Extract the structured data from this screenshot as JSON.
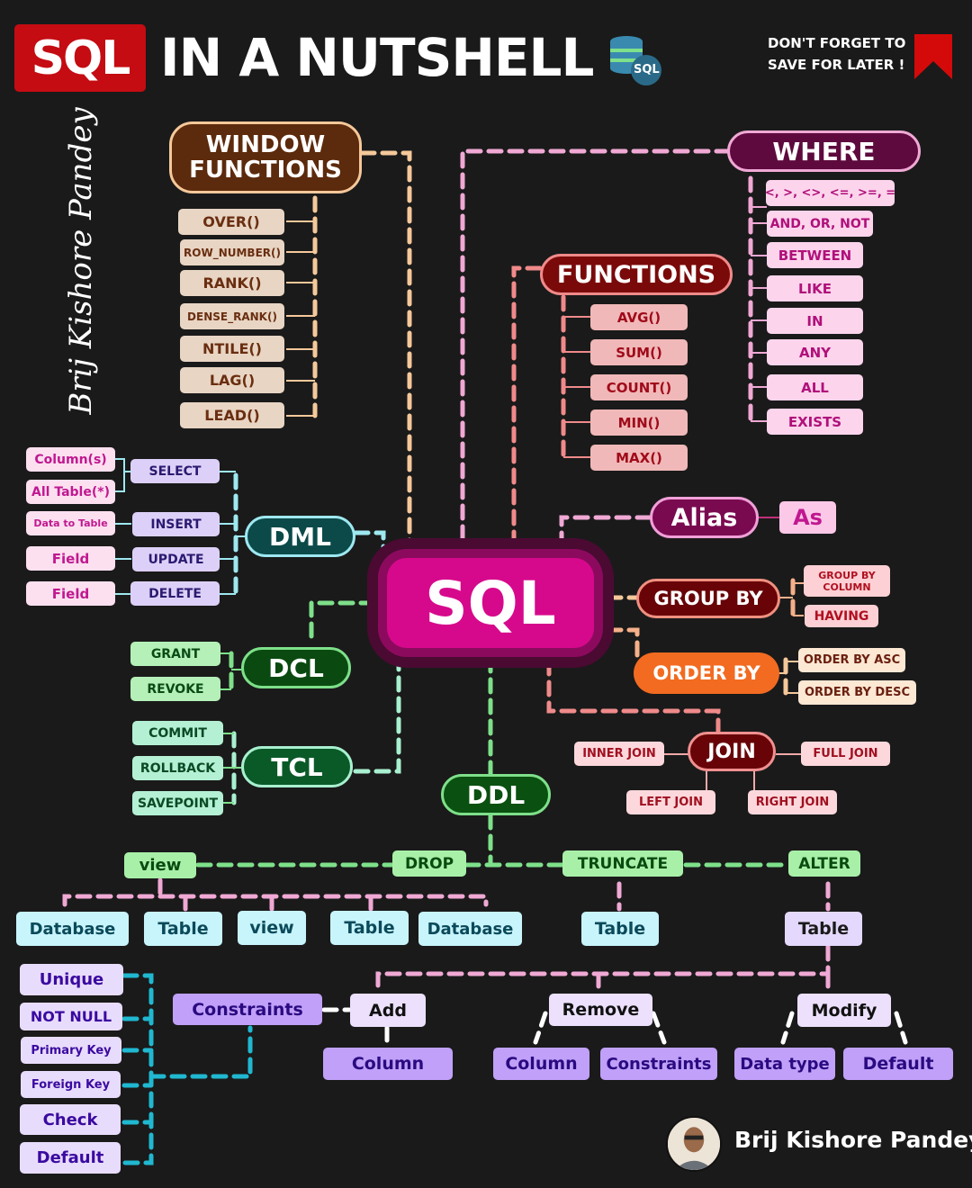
{
  "header": {
    "title_badge": "SQL",
    "title_text": "IN A NUTSHELL",
    "logo_text": "SQL",
    "save_note_line1": "DON'T FORGET TO",
    "save_note_line2": "SAVE FOR LATER !"
  },
  "author": {
    "vertical_signature": "Brij Kishore Pandey",
    "name": "Brij Kishore Pandey"
  },
  "center": {
    "label": "SQL"
  },
  "window_functions": {
    "title": "WINDOW FUNCTIONS",
    "items": [
      "OVER()",
      "ROW_NUMBER()",
      "RANK()",
      "DENSE_RANK()",
      "NTILE()",
      "LAG()",
      "LEAD()"
    ]
  },
  "where": {
    "title": "WHERE",
    "items": [
      "<, >, <>, <=, >=, =",
      "AND, OR, NOT",
      "BETWEEN",
      "LIKE",
      "IN",
      "ANY",
      "ALL",
      "EXISTS"
    ]
  },
  "functions": {
    "title": "FUNCTIONS",
    "items": [
      "AVG()",
      "SUM()",
      "COUNT()",
      "MIN()",
      "MAX()"
    ]
  },
  "dml": {
    "title": "DML",
    "commands": [
      "SELECT",
      "INSERT",
      "UPDATE",
      "DELETE"
    ],
    "targets": [
      "Column(s)",
      "All Table(*)",
      "Data to Table",
      "Field",
      "Field"
    ]
  },
  "alias": {
    "title": "Alias",
    "item": "As"
  },
  "group_by": {
    "title": "GROUP BY",
    "items": [
      "GROUP BY COLUMN",
      "HAVING"
    ]
  },
  "order_by": {
    "title": "ORDER BY",
    "items": [
      "ORDER BY ASC",
      "ORDER BY DESC"
    ]
  },
  "dcl": {
    "title": "DCL",
    "items": [
      "GRANT",
      "REVOKE"
    ]
  },
  "tcl": {
    "title": "TCL",
    "items": [
      "COMMIT",
      "ROLLBACK",
      "SAVEPOINT"
    ]
  },
  "join": {
    "title": "JOIN",
    "items": [
      "INNER JOIN",
      "FULL JOIN",
      "LEFT JOIN",
      "RIGHT JOIN"
    ]
  },
  "ddl": {
    "title": "DDL",
    "commands": [
      "view",
      "DROP",
      "TRUNCATE",
      "ALTER"
    ],
    "drop_targets": [
      "Database",
      "Table",
      "view",
      "Table",
      "Database"
    ],
    "truncate_target": "Table",
    "alter_target": "Table",
    "alter_actions": [
      "Add",
      "Remove",
      "Modify"
    ],
    "add_items": [
      "Constraints",
      "Column"
    ],
    "remove_items": [
      "Column",
      "Constraints"
    ],
    "modify_items": [
      "Data type",
      "Default"
    ],
    "constraints": [
      "Unique",
      "NOT NULL",
      "Primary Key",
      "Foreign Key",
      "Check",
      "Default"
    ]
  },
  "colors": {
    "background": "#1a1a1a",
    "brand_red": "#c40c12",
    "sql_magenta": "#d6098c",
    "window_brown": "#5c2a0c",
    "where_plum": "#5e0a3e",
    "functions_maroon": "#7a0a0a",
    "dml_teal": "#0c4a4a",
    "dcl_green": "#0a4a10",
    "order_orange": "#f26b21"
  }
}
